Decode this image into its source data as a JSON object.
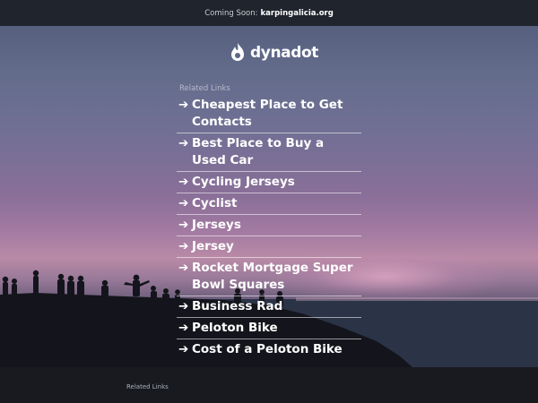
{
  "topbar": {
    "prefix": "Coming Soon:",
    "domain": "karpingalicia.org"
  },
  "logo": {
    "text": "dynadot",
    "icon": "dynadot-flame-icon"
  },
  "related": {
    "heading": "Related Links",
    "arrow": "➔",
    "items": [
      {
        "label": "Cheapest Place to Get Contacts"
      },
      {
        "label": "Best Place to Buy a Used Car"
      },
      {
        "label": "Cycling Jerseys"
      },
      {
        "label": "Cyclist"
      },
      {
        "label": "Jerseys"
      },
      {
        "label": "Jersey"
      },
      {
        "label": "Rocket Mortgage Super Bowl Squares"
      },
      {
        "label": "Business Rad"
      },
      {
        "label": "Peloton Bike"
      },
      {
        "label": "Cost of a Peloton Bike"
      }
    ]
  },
  "footer": {
    "link": "Related Links"
  },
  "colors": {
    "topbar": "#20242d",
    "footer": "#181a1f",
    "link_text": "#ffffff"
  }
}
